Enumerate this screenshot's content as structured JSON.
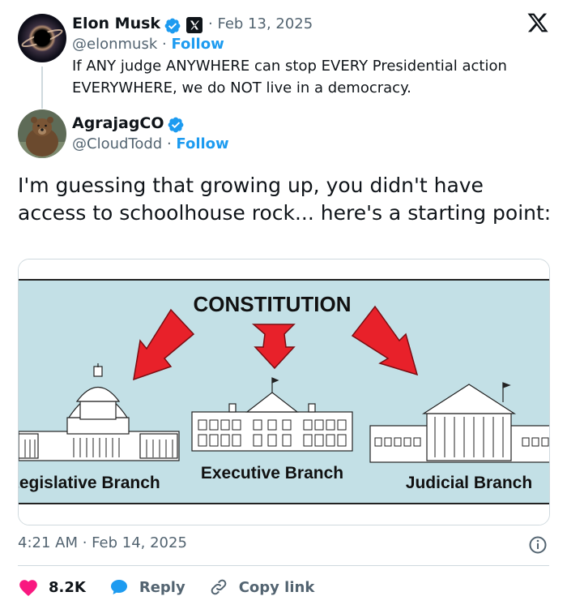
{
  "quoted": {
    "name": "Elon Musk",
    "handle": "@elonmusk",
    "follow": "Follow",
    "date": "· Feb 13, 2025",
    "text": "If ANY judge ANYWHERE can stop EVERY Presidential action EVERYWHERE, we do NOT live in a democracy."
  },
  "author": {
    "name": "AgrajagCO",
    "handle": "@CloudTodd",
    "follow": "Follow",
    "text": "I'm guessing that growing up, you didn't have access to schoolhouse rock... here's a starting point:"
  },
  "image": {
    "title": "CONSTITUTION",
    "left_label": "Legislative Branch",
    "center_label": "Executive Branch",
    "right_label": "Judicial Branch"
  },
  "meta": {
    "timestamp": "4:21 AM · Feb 14, 2025"
  },
  "actions": {
    "likes": "8.2K",
    "reply": "Reply",
    "copy": "Copy link"
  },
  "colors": {
    "accent": "#1d9bf0",
    "like": "#f91880",
    "diagram_bg": "#c3e0e6",
    "arrow": "#e8212a"
  },
  "icons": [
    "verified-badge-icon",
    "x-affiliate-icon",
    "x-logo-icon",
    "info-icon",
    "heart-icon",
    "reply-bubble-icon",
    "link-icon"
  ]
}
